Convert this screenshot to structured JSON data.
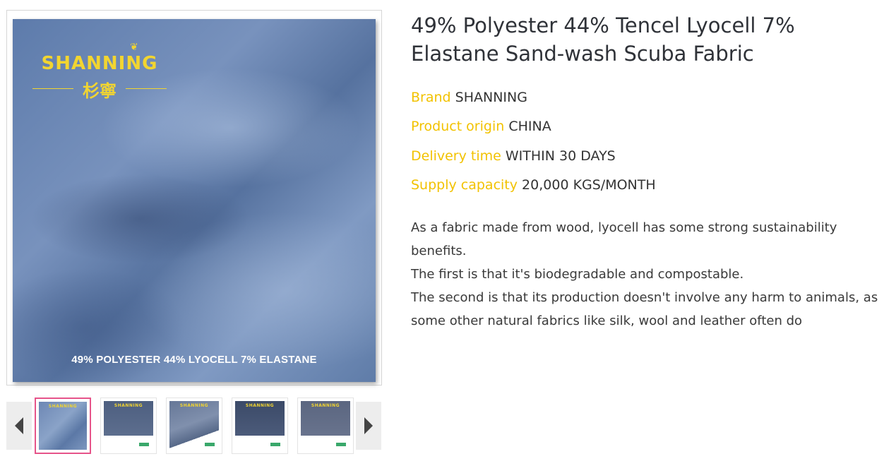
{
  "product": {
    "title": "49% Polyester 44% Tencel Lyocell 7% Elastane Sand-wash Scuba Fabric",
    "image_caption": "49% POLYESTER 44% LYOCELL 7% ELASTANE",
    "logo": {
      "word": "SHANNING",
      "chinese": "杉寧"
    }
  },
  "specs": [
    {
      "label": "Brand",
      "value": "SHANNING"
    },
    {
      "label": "Product origin",
      "value": "CHINA"
    },
    {
      "label": "Delivery time",
      "value": "WITHIN 30 DAYS"
    },
    {
      "label": "Supply capacity",
      "value": "20,000 KGS/MONTH"
    }
  ],
  "description": [
    "As a fabric made from wood, lyocell has some strong sustainability benefits.",
    "The first is that it's biodegradable and compostable.",
    "The second is that its production doesn't involve any harm to animals, as some other natural fabrics like silk, wool and leather often do"
  ],
  "gallery": {
    "selected_index": 0,
    "thumbnail_count": 5,
    "prev_icon": "chevron-left-icon",
    "next_icon": "chevron-right-icon",
    "active_border_color": "#e6548a"
  },
  "colors": {
    "label_accent": "#f2c200",
    "logo_gold": "#f2d530"
  }
}
